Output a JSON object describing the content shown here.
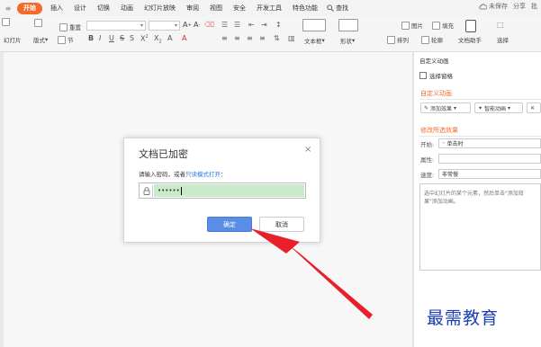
{
  "menubar": {
    "tabs": [
      "开始",
      "插入",
      "设计",
      "切换",
      "动画",
      "幻灯片放映",
      "审阅",
      "视图",
      "安全",
      "开发工具",
      "特色功能"
    ],
    "active_tab": "开始",
    "search_label": "查找",
    "save_status": "未保存",
    "share": "分享",
    "annotation": "批"
  },
  "ribbon": {
    "reset": "重置",
    "slide_btn": "幻灯片",
    "layout": "版式",
    "section": "节",
    "paste_label": "粘贴",
    "textbox": "文本框",
    "shapes": "形状",
    "arrange": "排列",
    "outline": "轮廓",
    "picture": "图片",
    "fill": "填充",
    "doc_helper": "文档助手",
    "select": "选择"
  },
  "panel": {
    "title": "自定义动画",
    "select_pane": "选择窗格",
    "custom_anim_section": "自定义动画",
    "add_effect": "添加效果",
    "smart_anim": "智能动画",
    "modify_section": "修改所选效果",
    "start_label": "开始:",
    "start_value": "单击时",
    "property_label": "属性:",
    "speed_label": "速度:",
    "speed_value": "非常慢",
    "description": "选中幻灯片的某个元素，然后单击\"添加效果\"添加动画。"
  },
  "dialog": {
    "title": "文档已加密",
    "close_symbol": "×",
    "prompt_prefix": "请输入密码，或者",
    "prompt_link": "只读模式打开",
    "prompt_suffix": "：",
    "password_value": "••••••",
    "ok_label": "确定",
    "cancel_label": "取消"
  },
  "watermark": {
    "text": "最需教育"
  },
  "colors": {
    "accent": "#f26b28",
    "primary_button": "#5a8ee6",
    "link": "#2d7be0",
    "arrow": "#e8202a",
    "watermark": "#1a3fb0"
  }
}
